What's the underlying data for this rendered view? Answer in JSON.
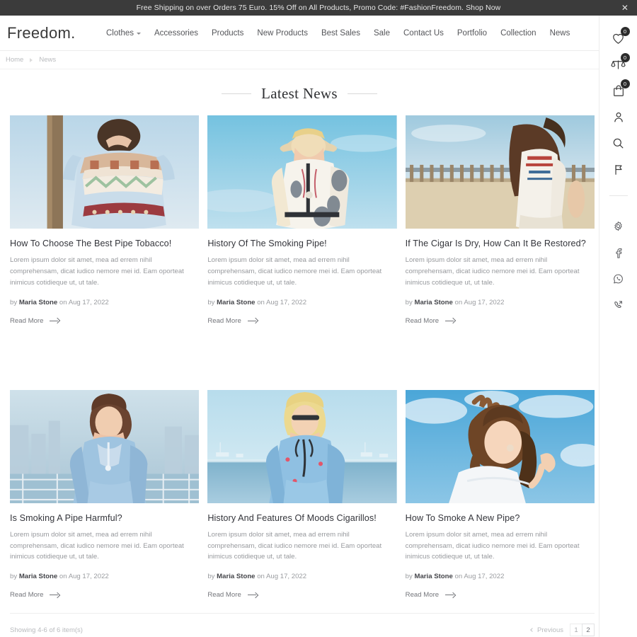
{
  "promo": {
    "message": "Free Shipping on over Orders 75 Euro. 15% Off on All Products, Promo Code: #FashionFreedom. Shop Now",
    "close_label": "✕"
  },
  "header": {
    "brand": "Freedom.",
    "nav": [
      {
        "label": "Clothes",
        "has_dropdown": true
      },
      {
        "label": "Accessories",
        "has_dropdown": false
      },
      {
        "label": "Products",
        "has_dropdown": false
      },
      {
        "label": "New Products",
        "has_dropdown": false
      },
      {
        "label": "Best Sales",
        "has_dropdown": false
      },
      {
        "label": "Sale",
        "has_dropdown": false
      },
      {
        "label": "Contact Us",
        "has_dropdown": false
      },
      {
        "label": "Portfolio",
        "has_dropdown": false
      },
      {
        "label": "Collection",
        "has_dropdown": false
      },
      {
        "label": "News",
        "has_dropdown": false
      }
    ]
  },
  "breadcrumb": {
    "home": "Home",
    "current": "News"
  },
  "rail": {
    "wishlist_count": "0",
    "compare_count": "0",
    "cart_count": "0"
  },
  "main": {
    "page_title": "Latest News"
  },
  "articles": [
    {
      "title": "How To Choose The Best Pipe Tobacco!",
      "excerpt": "Lorem ipsum dolor sit amet, mea ad errem nihil comprehensam, dicat iudico nemore mei id. Eam oporteat inimicus cotidieque ut, ut tale.",
      "meta_prefix": "by",
      "author": "Maria Stone",
      "meta_middle": "on",
      "date": "Aug 17, 2022",
      "read_more": "Read More"
    },
    {
      "title": "History Of The Smoking Pipe!",
      "excerpt": "Lorem ipsum dolor sit amet, mea ad errem nihil comprehensam, dicat iudico nemore mei id. Eam oporteat inimicus cotidieque ut, ut tale.",
      "meta_prefix": "by",
      "author": "Maria Stone",
      "meta_middle": "on",
      "date": "Aug 17, 2022",
      "read_more": "Read More"
    },
    {
      "title": "If The Cigar Is Dry, How Can It Be Restored?",
      "excerpt": "Lorem ipsum dolor sit amet, mea ad errem nihil comprehensam, dicat iudico nemore mei id. Eam oporteat inimicus cotidieque ut, ut tale.",
      "meta_prefix": "by",
      "author": "Maria Stone",
      "meta_middle": "on",
      "date": "Aug 17, 2022",
      "read_more": "Read More"
    },
    {
      "title": "Is Smoking A Pipe Harmful?",
      "excerpt": "Lorem ipsum dolor sit amet, mea ad errem nihil comprehensam, dicat iudico nemore mei id. Eam oporteat inimicus cotidieque ut, ut tale.",
      "meta_prefix": "by",
      "author": "Maria Stone",
      "meta_middle": "on",
      "date": "Aug 17, 2022",
      "read_more": "Read More"
    },
    {
      "title": "History And Features Of Moods Cigarillos!",
      "excerpt": "Lorem ipsum dolor sit amet, mea ad errem nihil comprehensam, dicat iudico nemore mei id. Eam oporteat inimicus cotidieque ut, ut tale.",
      "meta_prefix": "by",
      "author": "Maria Stone",
      "meta_middle": "on",
      "date": "Aug 17, 2022",
      "read_more": "Read More"
    },
    {
      "title": "How To Smoke A New Pipe?",
      "excerpt": "Lorem ipsum dolor sit amet, mea ad errem nihil comprehensam, dicat iudico nemore mei id. Eam oporteat inimicus cotidieque ut, ut tale.",
      "meta_prefix": "by",
      "author": "Maria Stone",
      "meta_middle": "on",
      "date": "Aug 17, 2022",
      "read_more": "Read More"
    }
  ],
  "pagination": {
    "showing": "Showing 4-6 of 6 item(s)",
    "previous": "Previous",
    "pages": [
      "1",
      "2"
    ],
    "current_page": "2"
  },
  "colors": {
    "promo_bg": "#3b3b3b",
    "badge_bg": "#2c2c2c",
    "text_dark": "#33343a",
    "text_muted": "#97999d"
  }
}
